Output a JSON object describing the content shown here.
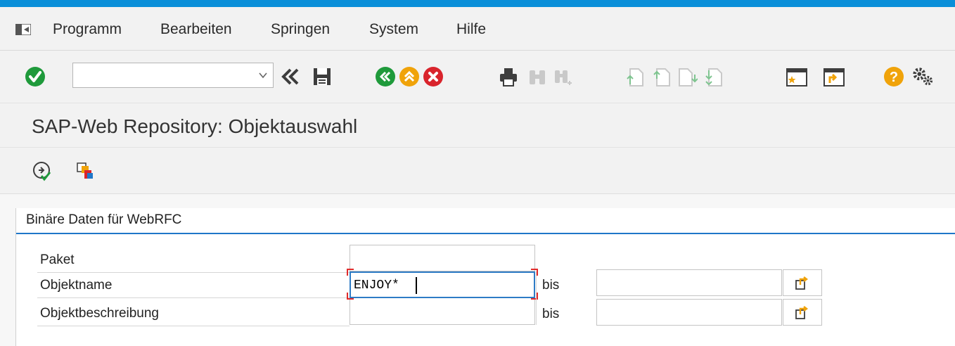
{
  "menu": {
    "items": [
      "Programm",
      "Bearbeiten",
      "Springen",
      "System",
      "Hilfe"
    ]
  },
  "toolbar": {
    "command_field_value": "",
    "icons": [
      "enter-icon",
      "command-field-dropdown-icon",
      "collapse-toolbar-icon",
      "save-icon",
      "back-icon",
      "exit-icon",
      "cancel-icon",
      "print-icon",
      "find-icon",
      "find-next-icon",
      "first-page-icon",
      "previous-page-icon",
      "next-page-icon",
      "last-page-icon",
      "new-session-icon",
      "shortcut-icon",
      "help-icon",
      "customize-layout-icon"
    ]
  },
  "title": "SAP-Web Repository: Objektauswahl",
  "app_toolbar": {
    "icons": [
      "execute-icon",
      "display-objects-icon"
    ]
  },
  "group": {
    "title": "Binäre Daten für WebRFC",
    "fields": [
      {
        "label": "Paket",
        "value": ""
      },
      {
        "label": "Objektname",
        "value": "ENJOY*",
        "to_label": "bis",
        "to_value": ""
      },
      {
        "label": "Objektbeschreibung",
        "value": "",
        "to_label": "bis",
        "to_value": ""
      }
    ]
  },
  "colors": {
    "accent": "#0a8fd9",
    "green": "#1f9a3b",
    "yellow": "#f0a30a",
    "red": "#d9242c"
  }
}
